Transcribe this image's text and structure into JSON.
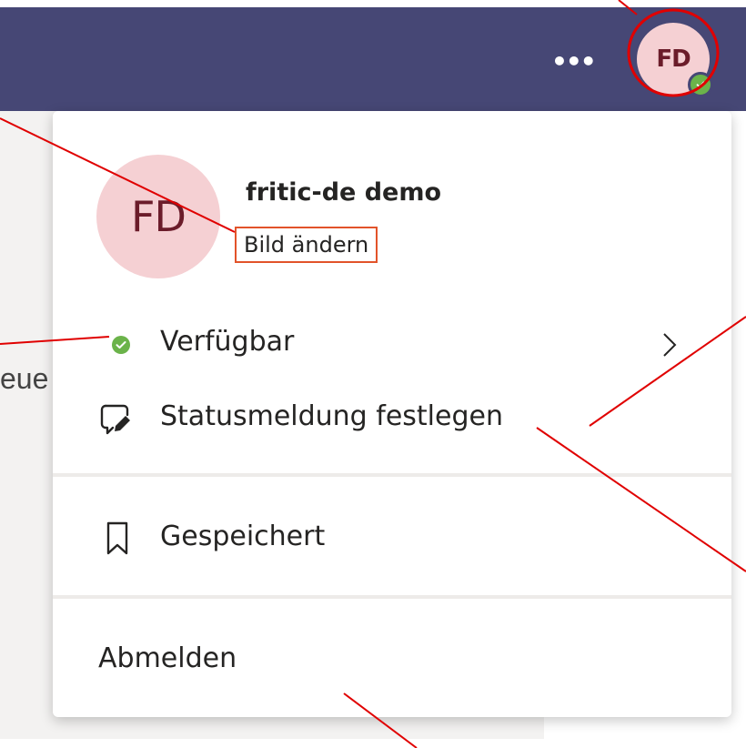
{
  "header": {
    "more_label": "•••",
    "avatar_initials": "FD"
  },
  "background": {
    "partial_text": "eue"
  },
  "profile": {
    "initials": "FD",
    "name": "fritic-de demo",
    "change_picture": "Bild ändern"
  },
  "menu": {
    "status": {
      "label": "Verfügbar",
      "icon": "available-status-icon",
      "color": "#6bb34a"
    },
    "status_message": {
      "label": "Statusmeldung festlegen",
      "icon": "edit-message-icon"
    },
    "saved": {
      "label": "Gespeichert",
      "icon": "bookmark-icon"
    },
    "sign_out": {
      "label": "Abmelden"
    }
  },
  "colors": {
    "header_bg": "#464775",
    "avatar_bg": "#f5d0d3",
    "avatar_text": "#6b1c2a",
    "annotation": "#e00000"
  }
}
